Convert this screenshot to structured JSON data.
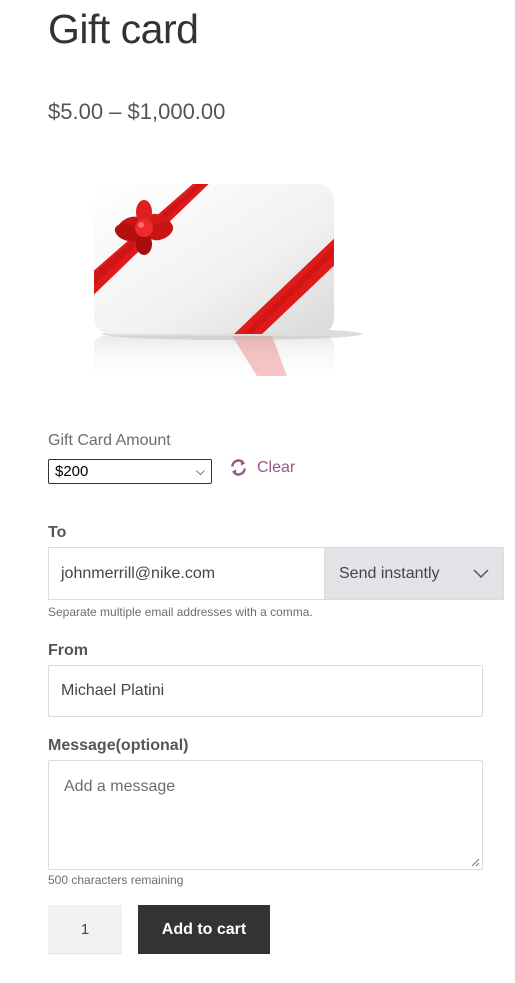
{
  "product": {
    "title": "Gift card",
    "price": "$5.00 – $1,000.00"
  },
  "amount": {
    "label": "Gift Card Amount",
    "selected": "$200",
    "clear_label": "Clear"
  },
  "to": {
    "label": "To",
    "value": "johnmerrill@nike.com",
    "send_option": "Send instantly",
    "hint": "Separate multiple email addresses with a comma."
  },
  "from": {
    "label": "From",
    "value": "Michael Platini"
  },
  "message": {
    "label": "Message(optional)",
    "placeholder": "Add a message",
    "remaining": "500 characters remaining"
  },
  "cart": {
    "quantity": "1",
    "add_label": "Add to cart"
  },
  "colors": {
    "accent": "#96588a",
    "button_bg": "#333333",
    "ribbon": "#e01a1a"
  }
}
